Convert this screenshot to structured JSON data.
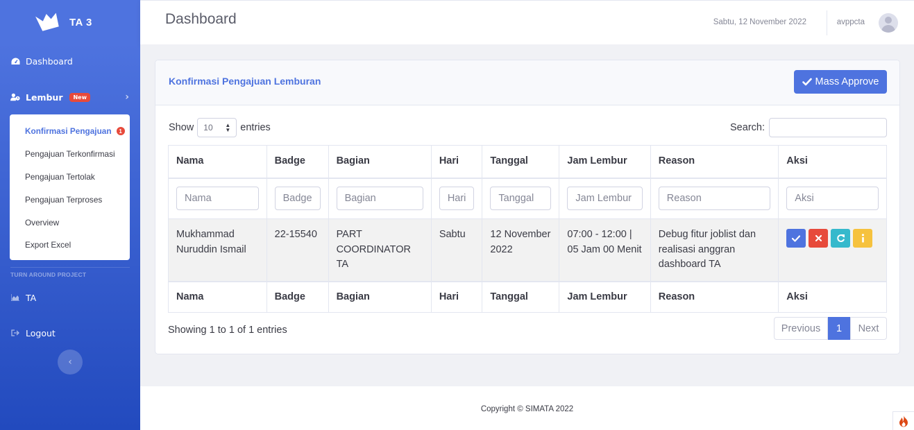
{
  "sidebar": {
    "brand": "TA 3",
    "dashboard_label": "Dashboard",
    "lembur_label": "Lembur",
    "lembur_badge": "New",
    "submenu": [
      {
        "label": "Konfirmasi Pengajuan",
        "count": "1",
        "active": true
      },
      {
        "label": "Pengajuan Terkonfirmasi"
      },
      {
        "label": "Pengajuan Tertolak"
      },
      {
        "label": "Pengajuan Terproses"
      },
      {
        "label": "Overview"
      },
      {
        "label": "Export Excel"
      }
    ],
    "section_heading": "TURN AROUND PROJECT",
    "ta_label": "TA",
    "logout_label": "Logout",
    "colors": {
      "gradient_top": "#4e73df",
      "gradient_bottom": "#224abe"
    }
  },
  "topbar": {
    "title": "Dashboard",
    "date": "Sabtu, 12 November 2022",
    "username": "avppcta"
  },
  "card": {
    "title": "Konfirmasi Pengajuan Lemburan",
    "mass_approve_label": "Mass Approve"
  },
  "datatable": {
    "show_label": "Show",
    "length_value": "10",
    "entries_label": "entries",
    "search_label": "Search:",
    "columns": [
      "Nama",
      "Badge",
      "Bagian",
      "Hari",
      "Tanggal",
      "Jam Lembur",
      "Reason",
      "Aksi"
    ],
    "filter_placeholders": [
      "Nama",
      "Badge",
      "Bagian",
      "Hari",
      "Tanggal",
      "Jam Lembur",
      "Reason",
      "Aksi"
    ],
    "rows": [
      {
        "nama": "Mukhammad Nuruddin Ismail",
        "badge": "22-15540",
        "bagian": "PART COORDINATOR TA",
        "hari": "Sabtu",
        "tanggal": "12 November 2022",
        "jam_lembur": "07:00 - 12:00 | 05 Jam 00 Menit",
        "reason": "Debug fitur joblist dan realisasi anggran dashboard TA"
      }
    ],
    "info": "Showing 1 to 1 of 1 entries",
    "pagination": {
      "previous": "Previous",
      "current": "1",
      "next": "Next"
    }
  },
  "footer": {
    "copyright": "Copyright © SIMATA 2022"
  },
  "icons": {
    "action_buttons": [
      "check-icon",
      "times-icon",
      "sync-icon",
      "info-icon"
    ]
  }
}
